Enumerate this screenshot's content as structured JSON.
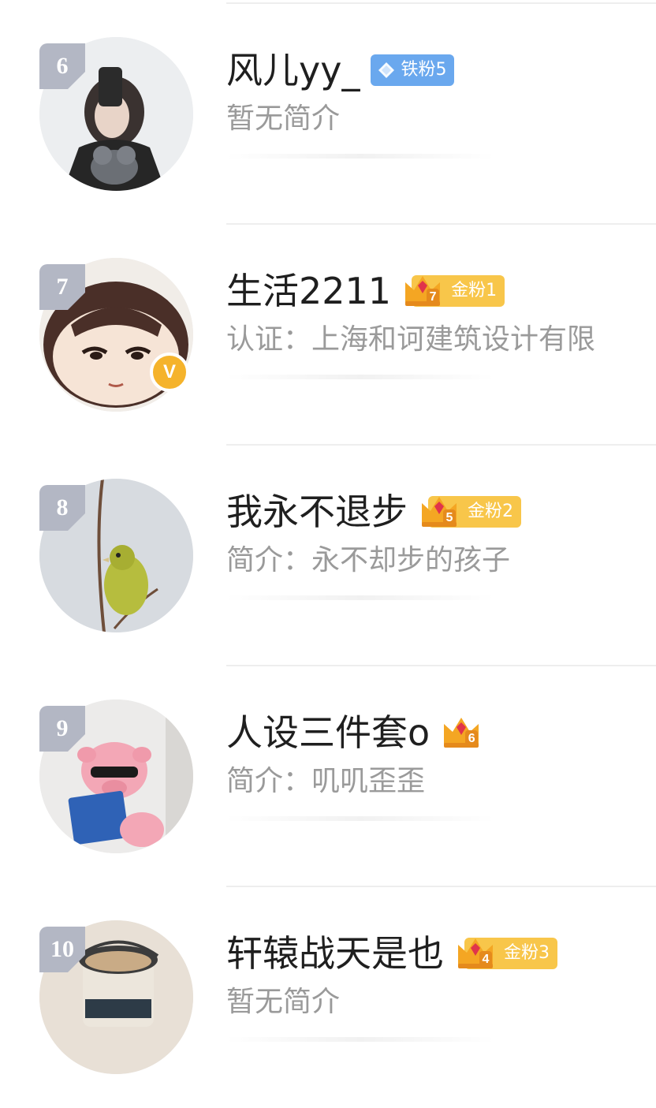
{
  "fans": [
    {
      "rank": "6",
      "name": "风儿yy_",
      "badge": {
        "type": "iron",
        "label": "铁粉5"
      },
      "bio": "暂无简介",
      "verified": false,
      "avatar": "girl-mirror-selfie-photo"
    },
    {
      "rank": "7",
      "name": "生活2211",
      "badge": {
        "type": "gold",
        "level": "7",
        "label": "金粉1"
      },
      "bio": "认证：上海和诃建筑设计有限",
      "verified": true,
      "verified_mark": "V",
      "avatar": "cartoon-child-face"
    },
    {
      "rank": "8",
      "name": "我永不退步",
      "badge": {
        "type": "gold",
        "level": "5",
        "label": "金粉2"
      },
      "bio": "简介：永不却步的孩子",
      "verified": false,
      "avatar": "green-bird-on-branch"
    },
    {
      "rank": "9",
      "name": "人设三件套o",
      "badge": {
        "type": "gold-crown-only",
        "level": "6",
        "label": ""
      },
      "bio": "简介：叽叽歪歪",
      "verified": false,
      "avatar": "pink-pig-plush-reading"
    },
    {
      "rank": "10",
      "name": "轩辕战天是也",
      "badge": {
        "type": "gold",
        "level": "4",
        "label": "金粉3"
      },
      "bio": "暂无简介",
      "verified": false,
      "avatar": "milk-tea-bucket"
    }
  ],
  "colors": {
    "rank_bg": "#b3b7c4",
    "iron_badge": "#6aa8ee",
    "gold_badge": "#f8c64a",
    "verified": "#f5b32b",
    "name_text": "#1f1f1f",
    "bio_text": "#9a9a9a",
    "divider": "#eeeeee"
  }
}
